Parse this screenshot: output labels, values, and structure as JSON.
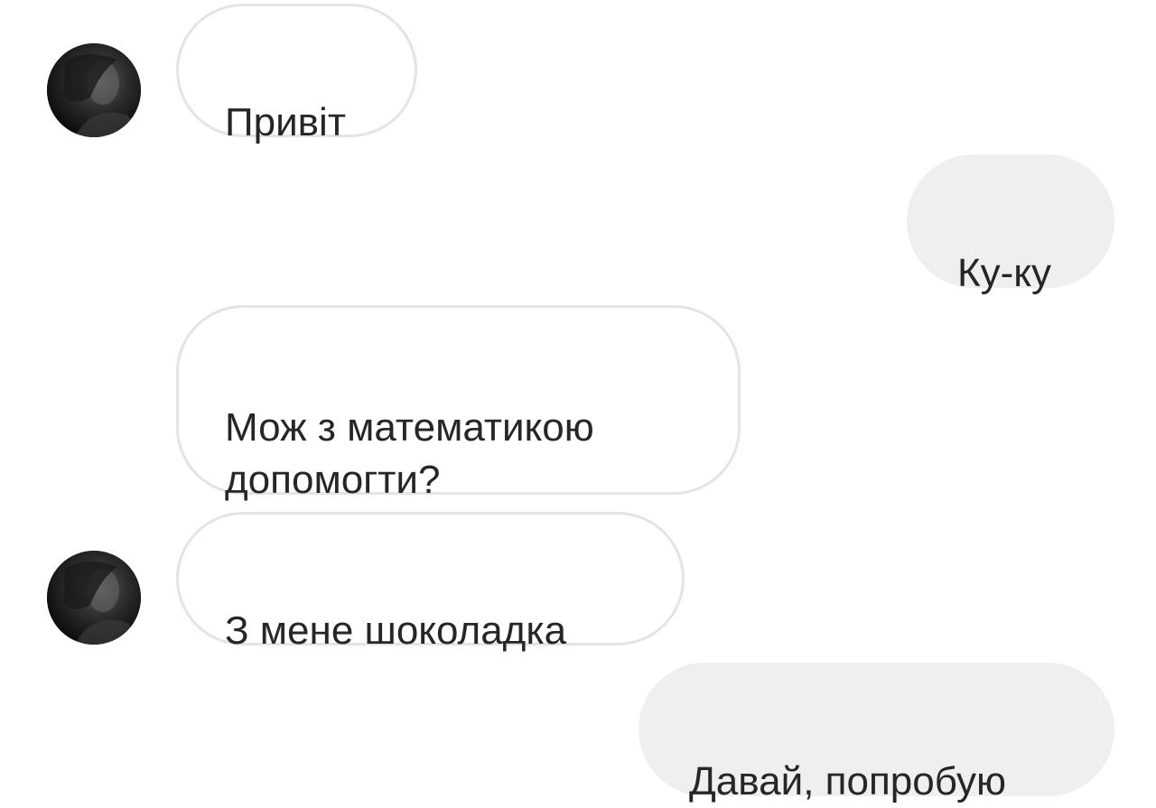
{
  "messages": [
    {
      "direction": "incoming",
      "text": "Привіт",
      "has_avatar": true
    },
    {
      "direction": "outgoing",
      "text": "Ку-ку"
    },
    {
      "direction": "incoming",
      "text": "Мож з математикою\nдопомогти?",
      "has_avatar": false
    },
    {
      "direction": "incoming",
      "text": "З мене шоколадка",
      "has_avatar": true
    },
    {
      "direction": "outgoing",
      "text": "Давай, попробую"
    }
  ],
  "colors": {
    "incoming_bubble_bg": "#ffffff",
    "incoming_bubble_border": "#e4e4e4",
    "outgoing_bubble_bg": "#efefef",
    "text": "#262626",
    "avatar_bg": "#151515"
  },
  "icons": {
    "contact_avatar": "contact-avatar"
  }
}
